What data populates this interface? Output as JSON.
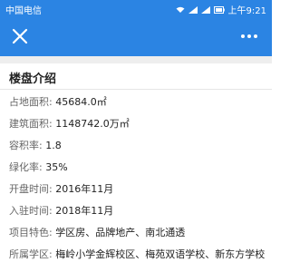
{
  "status": {
    "carrier": "中国电信",
    "time": "上午9:21"
  },
  "nav": {
    "close_icon": "close-icon",
    "more_icon": "more-dots-icon"
  },
  "section": {
    "title": "楼盘介绍"
  },
  "info": [
    {
      "key": "占地面积:",
      "value": "45684.0㎡"
    },
    {
      "key": "建筑面积:",
      "value": "1148742.0万㎡"
    },
    {
      "key": "容积率:",
      "value": "1.8"
    },
    {
      "key": "绿化率:",
      "value": "35%"
    },
    {
      "key": "开盘时间:",
      "value": "2016年11月"
    },
    {
      "key": "入驻时间:",
      "value": "2018年11月"
    },
    {
      "key": "项目特色:",
      "value": "学区房、品牌地产、南北通透"
    },
    {
      "key": "所属学区:",
      "value": "梅岭小学金辉校区、梅苑双语学校、新东方学校"
    }
  ],
  "colors": {
    "accent": "#2b84e3"
  }
}
